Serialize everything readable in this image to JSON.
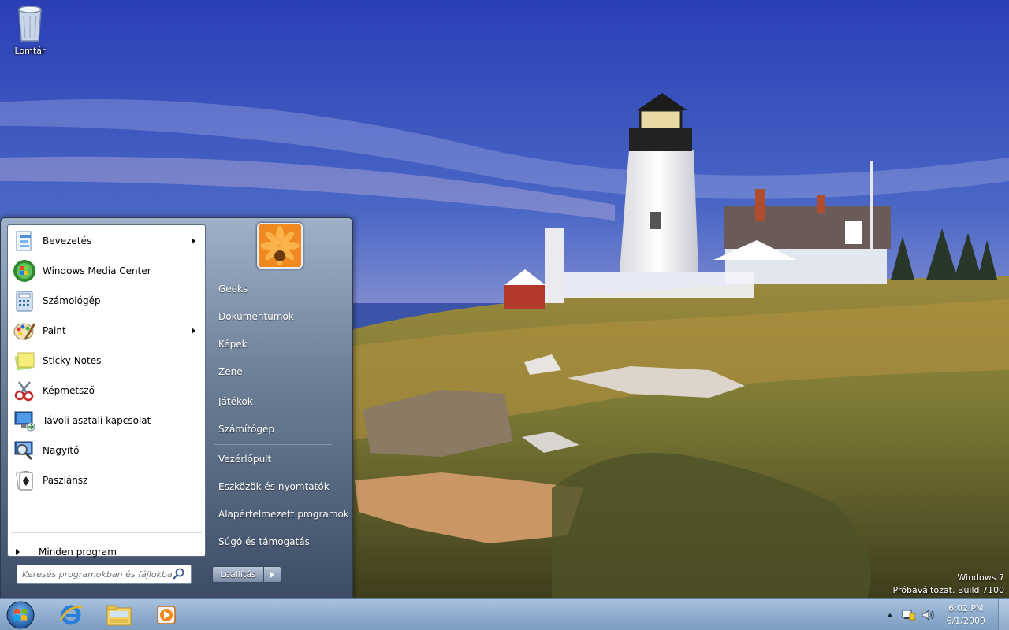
{
  "desktop": {
    "icons": [
      {
        "label": "Lomtár",
        "icon": "recycle-bin-icon"
      }
    ],
    "watermark": {
      "line1": "Windows 7",
      "line2": "Próbaváltozat. Build 7100"
    }
  },
  "start_menu": {
    "programs": [
      {
        "label": "Bevezetés",
        "icon": "getting-started-icon",
        "submenu": true
      },
      {
        "label": "Windows Media Center",
        "icon": "media-center-icon",
        "submenu": false
      },
      {
        "label": "Számológép",
        "icon": "calculator-icon",
        "submenu": false
      },
      {
        "label": "Paint",
        "icon": "paint-icon",
        "submenu": true
      },
      {
        "label": "Sticky Notes",
        "icon": "sticky-notes-icon",
        "submenu": false
      },
      {
        "label": "Képmetsző",
        "icon": "snipping-tool-icon",
        "submenu": false
      },
      {
        "label": "Távoli asztali kapcsolat",
        "icon": "remote-desktop-icon",
        "submenu": false
      },
      {
        "label": "Nagyító",
        "icon": "magnifier-icon",
        "submenu": false
      },
      {
        "label": "Pasziánsz",
        "icon": "solitaire-icon",
        "submenu": false
      }
    ],
    "all_programs": "Minden program",
    "search_placeholder": "Keresés programokban és fájlokban",
    "places": [
      "Geeks",
      "Dokumentumok",
      "Képek",
      "Zene",
      "Játékok",
      "Számítógép",
      "Vezérlőpult",
      "Eszközök és nyomtatók",
      "Alapértelmezett programok",
      "Súgó és támogatás"
    ],
    "shutdown_label": "Leállítás"
  },
  "taskbar": {
    "pinned": [
      "internet-explorer-icon",
      "windows-explorer-icon",
      "media-player-icon"
    ],
    "tray_icons": [
      "show-hidden-icons-icon",
      "network-flag-icon",
      "volume-icon"
    ],
    "clock": {
      "time": "6:02 PM",
      "date": "6/1/2009"
    }
  },
  "colors": {
    "taskbar": "#8fadcf",
    "sky": "#3a56b8",
    "start_menu": "#6f8199"
  }
}
